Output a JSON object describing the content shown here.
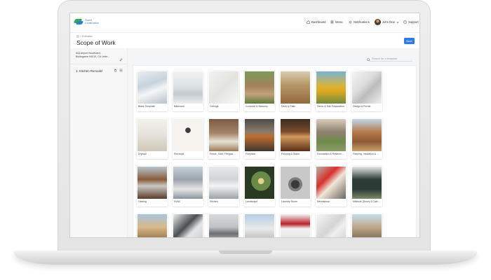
{
  "app": {
    "logo_line1": "Sweet",
    "logo_line2": "Construction"
  },
  "navbar": {
    "dashboard": "Dashboard",
    "menu": "Menu",
    "notifications": "Notifications",
    "user": "John Doe",
    "support": "Support"
  },
  "header": {
    "breadcrumb": "< Estimates",
    "title": "Scope of Work",
    "next_label": "Next"
  },
  "sidebar": {
    "address_line1": "533 Airport Boulevard,",
    "address_line2": "Burlingame 94010, CA Unite...",
    "items": [
      {
        "label": "1. Kitchen Remodel"
      }
    ]
  },
  "search": {
    "placeholder": "Search for a template"
  },
  "templates": [
    {
      "label": "Blank Template"
    },
    {
      "label": "Bathroom"
    },
    {
      "label": "Ceilings"
    },
    {
      "label": "Concrete & Masonry"
    },
    {
      "label": "Deck & Patio"
    },
    {
      "label": "Demo & Site Preparation"
    },
    {
      "label": "Design & Permit"
    },
    {
      "label": "Drywall"
    },
    {
      "label": "Electrical"
    },
    {
      "label": "Fence, Gate, Pergola & ..."
    },
    {
      "label": "Fireplace"
    },
    {
      "label": "Flooring & Stairs"
    },
    {
      "label": "Foundation & Retaining ..."
    },
    {
      "label": "Framing, Insulation & Dr..."
    },
    {
      "label": "Glazing"
    },
    {
      "label": "HVAC"
    },
    {
      "label": "Kitchen"
    },
    {
      "label": "Landscape"
    },
    {
      "label": "Laundry Room"
    },
    {
      "label": "Mechanical"
    },
    {
      "label": "Millwork (Doors & Cabin..."
    },
    {
      "label": ""
    },
    {
      "label": ""
    },
    {
      "label": ""
    },
    {
      "label": ""
    },
    {
      "label": ""
    },
    {
      "label": ""
    },
    {
      "label": ""
    }
  ]
}
